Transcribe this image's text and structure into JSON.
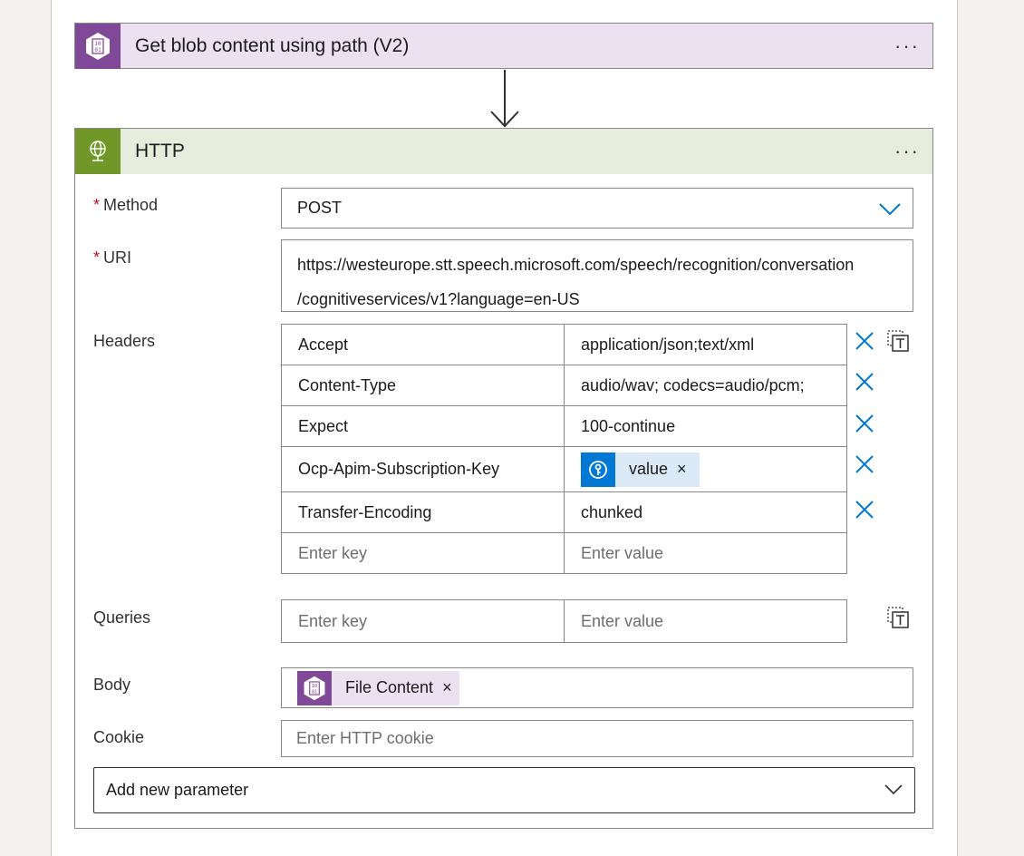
{
  "blob_action": {
    "title": "Get blob content using path (V2)",
    "more": "···",
    "icon": "blob-storage-icon",
    "color": "#804998"
  },
  "http_action": {
    "title": "HTTP",
    "more": "···",
    "icon": "http-globe-icon",
    "color": "#709727"
  },
  "required_mark": "*",
  "method": {
    "label": "Method",
    "value": "POST"
  },
  "uri": {
    "label": "URI",
    "line1": "https://westeurope.stt.speech.microsoft.com/speech/recognition/conversation",
    "line2": "/cognitiveservices/v1?language=en-US"
  },
  "headers": {
    "label": "Headers",
    "rows": [
      {
        "key": "Accept",
        "value": "application/json;text/xml"
      },
      {
        "key": "Content-Type",
        "value": "audio/wav; codecs=audio/pcm;"
      },
      {
        "key": "Expect",
        "value": "100-continue"
      },
      {
        "key": "Ocp-Apim-Subscription-Key",
        "value_token": "value"
      },
      {
        "key": "Transfer-Encoding",
        "value": "chunked"
      }
    ],
    "key_placeholder": "Enter key",
    "value_placeholder": "Enter value"
  },
  "queries": {
    "label": "Queries",
    "key_placeholder": "Enter key",
    "value_placeholder": "Enter value"
  },
  "body": {
    "label": "Body",
    "token": "File Content"
  },
  "cookie": {
    "label": "Cookie",
    "placeholder": "Enter HTTP cookie"
  },
  "add_parameter": {
    "label": "Add new parameter"
  },
  "token_remove": "×"
}
